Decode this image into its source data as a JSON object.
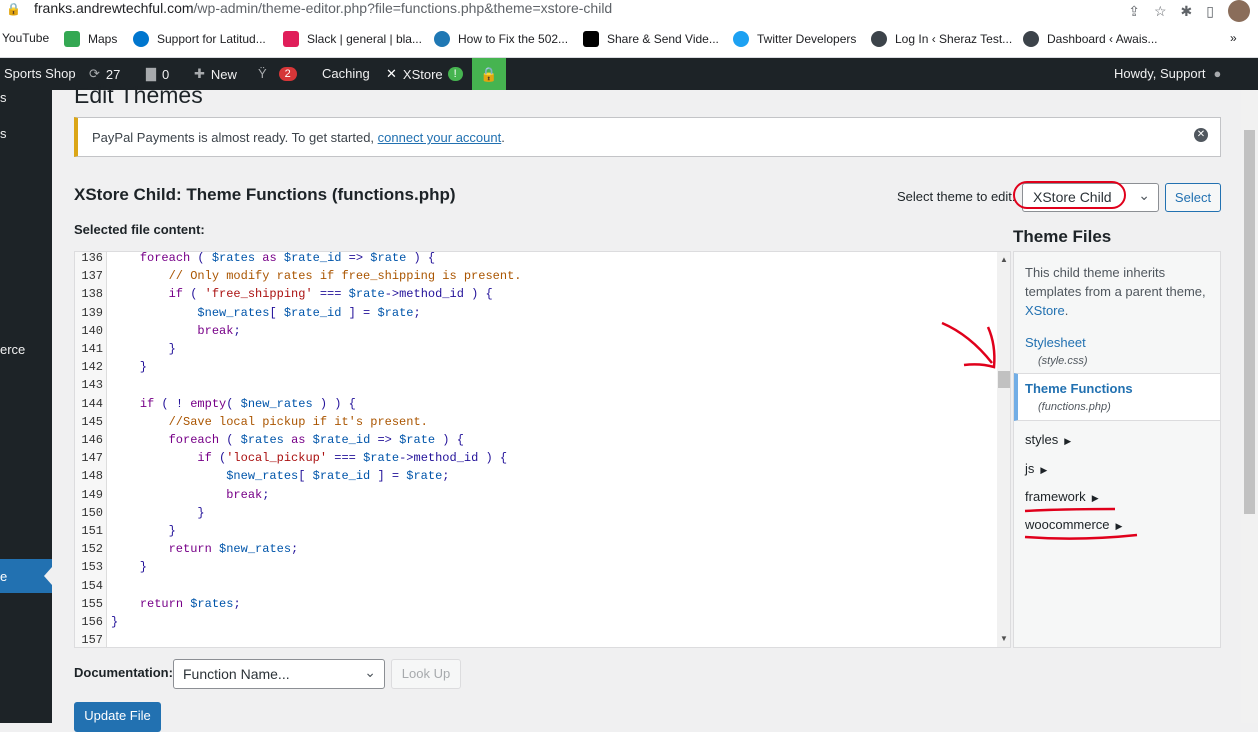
{
  "browser": {
    "url_host": "franks.andrewtechful.com",
    "url_path": "/wp-admin/theme-editor.php?file=functions.php&theme=xstore-child"
  },
  "bookmarks": [
    {
      "label": "YouTube",
      "color": "#ff0000"
    },
    {
      "label": "Maps",
      "color": "#34a853"
    },
    {
      "label": "Support for Latitud...",
      "color": "#0076ce"
    },
    {
      "label": "Slack | general | bla...",
      "color": "#611f69"
    },
    {
      "label": "How to Fix the 502...",
      "color": "#1f78b4"
    },
    {
      "label": "Share & Send Vide...",
      "color": "#000000"
    },
    {
      "label": "Twitter Developers",
      "color": "#1da1f2"
    },
    {
      "label": "Log In ‹ Sheraz Test...",
      "color": "#3c434a"
    },
    {
      "label": "Dashboard ‹ Awais...",
      "color": "#3c434a"
    }
  ],
  "adminbar": {
    "site": "Sports Shop",
    "updates": "27",
    "comments": "0",
    "new": "New",
    "yoast_count": "2",
    "caching": "Caching",
    "xstore": "XStore",
    "howdy": "Howdy, Support"
  },
  "sidebar": {
    "frag1": "s",
    "frag2": "s",
    "frag3": "erce",
    "frag4": "e"
  },
  "page": {
    "title": "Edit Themes",
    "notice_text": "PayPal Payments is almost ready. To get started, ",
    "notice_link": "connect your account",
    "notice_end": ".",
    "file_heading": "XStore Child: Theme Functions (functions.php)",
    "select_theme_label": "Select theme to edit:",
    "theme_value": "XStore Child",
    "select_button": "Select",
    "selected_file_label": "Selected file content:",
    "doc_label": "Documentation:",
    "doc_placeholder": "Function Name...",
    "lookup_button": "Look Up",
    "update_button": "Update File"
  },
  "code_lines": [
    {
      "n": "136",
      "t": "    foreach ( $rates as $rate_id => $rate ) {"
    },
    {
      "n": "137",
      "t": "        // Only modify rates if free_shipping is present."
    },
    {
      "n": "138",
      "t": "        if ( 'free_shipping' === $rate->method_id ) {"
    },
    {
      "n": "139",
      "t": "            $new_rates[ $rate_id ] = $rate;"
    },
    {
      "n": "140",
      "t": "            break;"
    },
    {
      "n": "141",
      "t": "        }"
    },
    {
      "n": "142",
      "t": "    }"
    },
    {
      "n": "143",
      "t": ""
    },
    {
      "n": "144",
      "t": "    if ( ! empty( $new_rates ) ) {"
    },
    {
      "n": "145",
      "t": "        //Save local pickup if it's present."
    },
    {
      "n": "146",
      "t": "        foreach ( $rates as $rate_id => $rate ) {"
    },
    {
      "n": "147",
      "t": "            if ('local_pickup' === $rate->method_id ) {"
    },
    {
      "n": "148",
      "t": "                $new_rates[ $rate_id ] = $rate;"
    },
    {
      "n": "149",
      "t": "                break;"
    },
    {
      "n": "150",
      "t": "            }"
    },
    {
      "n": "151",
      "t": "        }"
    },
    {
      "n": "152",
      "t": "        return $new_rates;"
    },
    {
      "n": "153",
      "t": "    }"
    },
    {
      "n": "154",
      "t": ""
    },
    {
      "n": "155",
      "t": "    return $rates;"
    },
    {
      "n": "156",
      "t": "}"
    },
    {
      "n": "157",
      "t": ""
    }
  ],
  "theme_files": {
    "heading": "Theme Files",
    "inherit_text": "This child theme inherits templates from a parent theme, ",
    "inherit_link": "XStore",
    "inherit_end": ".",
    "stylesheet": "Stylesheet",
    "stylesheet_file": "(style.css)",
    "functions": "Theme Functions",
    "functions_file": "(functions.php)",
    "folders": [
      "styles",
      "js",
      "framework",
      "woocommerce"
    ]
  }
}
